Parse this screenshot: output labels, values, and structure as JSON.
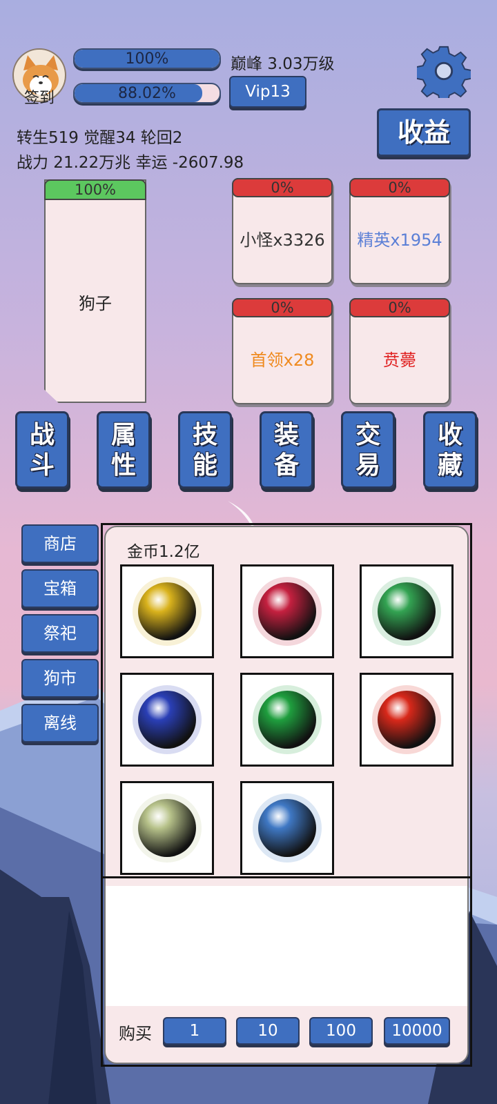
{
  "header": {
    "checkin_label": "签到",
    "exp_bar": {
      "text": "100%",
      "fill": 1.0
    },
    "sub_bar": {
      "text": "88.02%",
      "fill": 0.8802
    },
    "peak_text": "巅峰 3.03万级",
    "vip_label": "Vip13",
    "income_label": "收益",
    "stats_line1": "转生519 觉醒34 轮回2",
    "stats_line2": "战力 21.22万兆  幸运 -2607.98"
  },
  "player": {
    "hp_text": "100%",
    "hp_fill": 1.0,
    "name": "狗子"
  },
  "enemies": [
    {
      "hp_text": "0%",
      "name": "小怪x3326",
      "color": "#333333"
    },
    {
      "hp_text": "0%",
      "name": "精英x1954",
      "color": "#5b7fd6"
    },
    {
      "hp_text": "0%",
      "name": "首领x28",
      "color": "#ef8a1f"
    },
    {
      "hp_text": "0%",
      "name": "贲薨",
      "color": "#e02020"
    }
  ],
  "tabs": [
    {
      "top": "战",
      "bottom": "斗"
    },
    {
      "top": "属",
      "bottom": "性"
    },
    {
      "top": "技",
      "bottom": "能"
    },
    {
      "top": "装",
      "bottom": "备"
    },
    {
      "top": "交",
      "bottom": "易"
    },
    {
      "top": "收",
      "bottom": "藏"
    }
  ],
  "side_menu": [
    "商店",
    "宝箱",
    "祭祀",
    "狗市",
    "离线"
  ],
  "shop": {
    "gold_text": "金币1.2亿",
    "items": [
      {
        "icon": "gold-orb-icon",
        "color": "#d9b21c"
      },
      {
        "icon": "red-orb-icon",
        "color": "#c4203f"
      },
      {
        "icon": "green-orb-icon",
        "color": "#33a352"
      },
      {
        "icon": "blue-orb-icon",
        "color": "#2a3fb6"
      },
      {
        "icon": "dragon-green-orb-icon",
        "color": "#1f9e3e"
      },
      {
        "icon": "phoenix-fire-orb-icon",
        "color": "#d8281a"
      },
      {
        "icon": "tiger-white-orb-icon",
        "color": "#b7c28a"
      },
      {
        "icon": "dragon-blue-orb-icon",
        "color": "#3f78c4"
      }
    ],
    "buy_label": "购买",
    "quantities": [
      "1",
      "10",
      "100",
      "10000"
    ]
  }
}
